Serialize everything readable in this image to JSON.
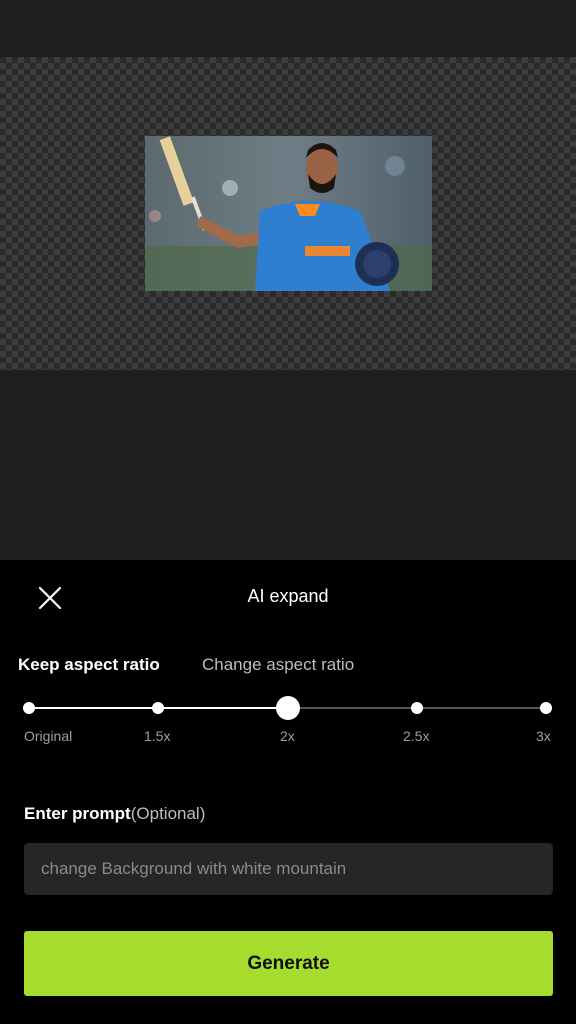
{
  "panel": {
    "title": "AI expand",
    "close_icon": "close-icon"
  },
  "tabs": [
    {
      "label": "Keep aspect ratio",
      "selected": true
    },
    {
      "label": "Change aspect ratio",
      "selected": false
    }
  ],
  "scale_slider": {
    "options": [
      "Original",
      "1.5x",
      "2x",
      "2.5x",
      "3x"
    ],
    "selected": "2x"
  },
  "prompt": {
    "label": "Enter prompt",
    "optional": "(Optional)",
    "value": "",
    "placeholder": "change Background with white mountain"
  },
  "generate": {
    "label": "Generate"
  },
  "colors": {
    "accent": "#a6dc2e",
    "panel_bg": "#000000",
    "preview_bg": "#1e1e1e"
  }
}
